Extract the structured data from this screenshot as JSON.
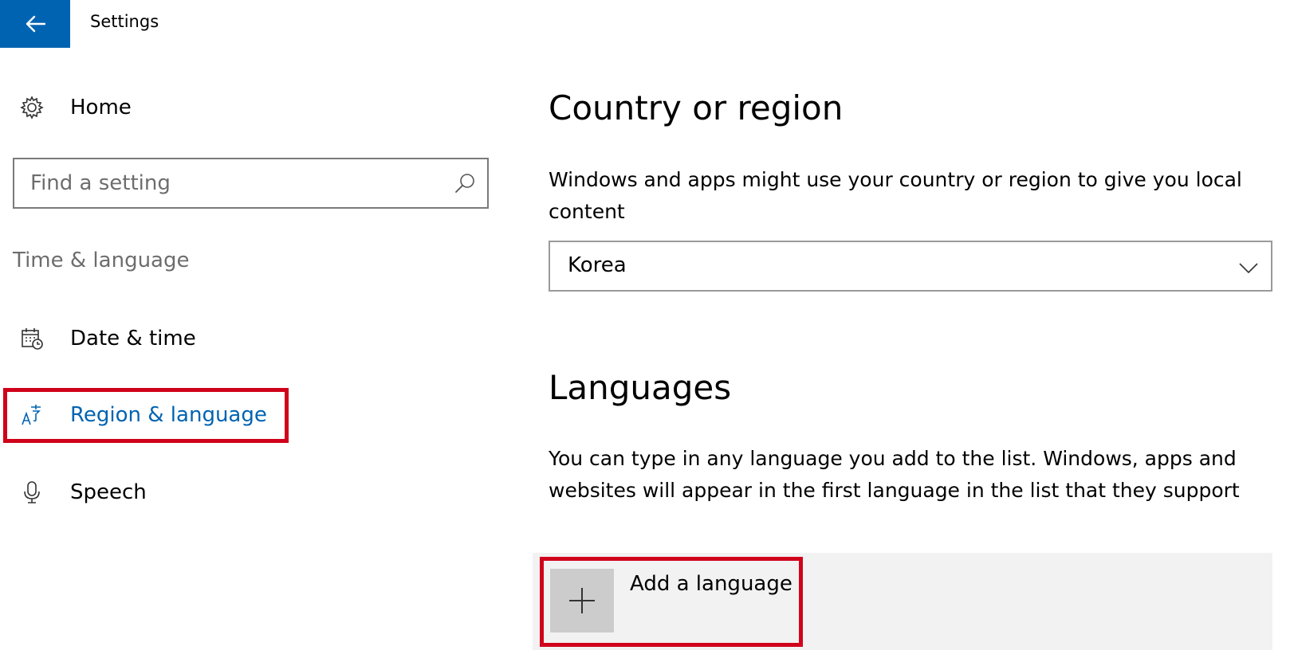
{
  "titlebar": {
    "title": "Settings"
  },
  "sidebar": {
    "home_label": "Home",
    "search_placeholder": "Find a setting",
    "section_label": "Time & language",
    "items": [
      {
        "label": "Date & time",
        "icon": "calendar-clock-icon"
      },
      {
        "label": "Region & language",
        "icon": "region-language-icon",
        "selected": true
      },
      {
        "label": "Speech",
        "icon": "microphone-icon"
      }
    ]
  },
  "main": {
    "country": {
      "heading": "Country or region",
      "description": "Windows and apps might use your country or region to give you local content",
      "selected_value": "Korea"
    },
    "languages": {
      "heading": "Languages",
      "description": "You can type in any language you add to the list. Windows, apps and websites will appear in the first language in the list that they support",
      "add_label": "Add a language"
    }
  },
  "colors": {
    "accent": "#0063b1",
    "highlight": "#d0021b",
    "row_background": "#f2f2f2",
    "tile_background": "#cccccc"
  }
}
